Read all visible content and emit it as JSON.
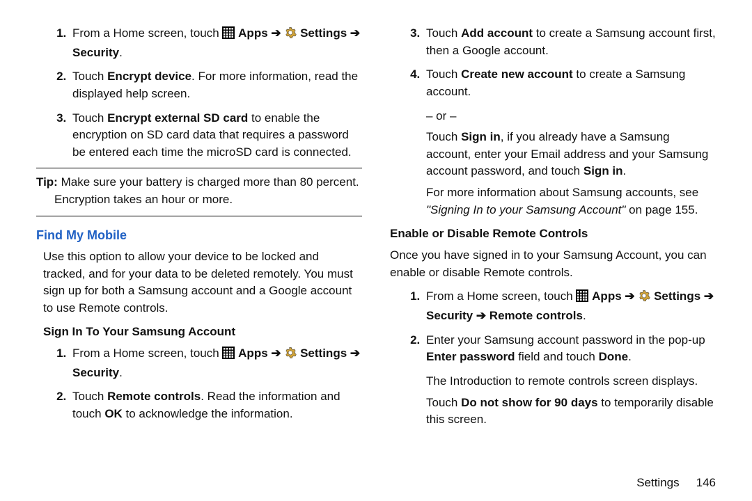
{
  "left": {
    "steps_a": [
      {
        "pre": "From a Home screen, touch ",
        "apps": "Apps",
        "arrow1": " ➔ ",
        "settings": "Settings",
        "arrow2": " ➔ ",
        "security": "Security",
        "post": "."
      },
      {
        "t1": "Touch ",
        "b1": "Encrypt device",
        "t2": ". For more information, read the displayed help screen."
      },
      {
        "t1": "Touch ",
        "b1": "Encrypt external SD card",
        "t2": " to enable the encryption on SD card data that requires a password be entered each time the microSD card is connected."
      }
    ],
    "tip_label": "Tip:",
    "tip_text": " Make sure your battery is charged more than 80 percent. Encryption takes an hour or more.",
    "section_title": "Find My Mobile",
    "intro": "Use this option to allow your device to be locked and tracked, and for your data to be deleted remotely. You must sign up for both a Samsung account and a Google account to use Remote controls.",
    "subhead": "Sign In To Your Samsung Account",
    "steps_b": [
      {
        "pre": "From a Home screen, touch ",
        "apps": "Apps",
        "arrow1": " ➔ ",
        "settings": "Settings",
        "arrow2": " ➔ ",
        "security": "Security",
        "post": "."
      },
      {
        "t1": "Touch ",
        "b1": "Remote controls",
        "t2": ". Read the information and touch ",
        "b2": "OK",
        "t3": " to acknowledge the information."
      }
    ]
  },
  "right": {
    "steps_c": [
      {
        "num": "3.",
        "t1": "Touch ",
        "b1": "Add account",
        "t2": " to create a Samsung account first, then a Google account."
      },
      {
        "num": "4.",
        "t1": "Touch ",
        "b1": "Create new account",
        "t2": " to create a Samsung account."
      }
    ],
    "or": "– or –",
    "signin_t1": "Touch ",
    "signin_b1": "Sign in",
    "signin_t2": ", if you already have a Samsung account, enter your Email address and your Samsung account password, and touch ",
    "signin_b2": "Sign in",
    "signin_t3": ".",
    "more_info": "For more information about Samsung accounts, see ",
    "more_info_title": "\"Signing In to your Samsung Account\"",
    "more_info_pg": " on page 155.",
    "subhead": "Enable or Disable Remote Controls",
    "intro": "Once you have signed in to your Samsung Account, you can enable or disable Remote controls.",
    "steps_d": [
      {
        "pre": "From a Home screen, touch ",
        "apps": "Apps",
        "arrow1": " ➔ ",
        "settings": "Settings",
        "arrow2": " ➔ ",
        "security": "Security",
        "arrow3": " ➔ ",
        "remote": "Remote controls",
        "post": "."
      },
      {
        "t1": "Enter your Samsung account password in the pop-up ",
        "b1": "Enter password",
        "t2": " field and touch ",
        "b2": "Done",
        "t3": "."
      }
    ],
    "after1": "The Introduction to remote controls screen displays.",
    "after2_t1": "Touch ",
    "after2_b1": "Do not show for 90 days",
    "after2_t2": " to temporarily disable this screen."
  },
  "footer": {
    "section": "Settings",
    "page": "146"
  },
  "icons": {
    "apps": "apps-grid-icon",
    "settings": "settings-gear-icon"
  }
}
